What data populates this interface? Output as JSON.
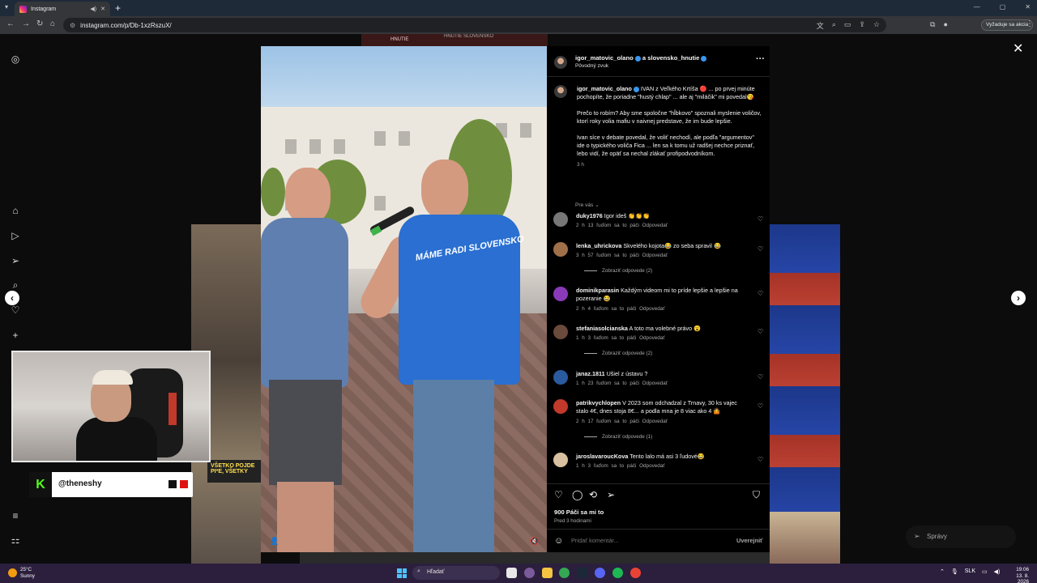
{
  "browser": {
    "tab_title": "Instagram",
    "url": "instagram.com/p/Db-1xzRszuX/",
    "action_pill": "Vyžaduje sa akcia"
  },
  "background": {
    "top_label_1": "HNUTIE",
    "top_label_2": "HNUTIE SLOVENSKO",
    "left_banner": "VŠETKO POJDE PI*E, VŠETKY"
  },
  "post": {
    "header_user": "igor_matovic_olano",
    "header_conj": "a",
    "header_user2": "slovensko_hnutie",
    "audio": "Pôvodný zvuk",
    "caption_user": "igor_matovic_olano",
    "caption_p1": "IVAN z Veľkého Krtíša 🔴 ... po prvej minúte pochopíte, že poriadne \"hustý chlap\" ... ale aj \"miláčik\" mi povedal😘",
    "caption_p2": "Prečo to robím? Aby sme spoločne \"hĺbkovo\" spoznali myslenie voličov, ktorí roky volia mafiu v naivnej predstave, že im bude lepšie.",
    "caption_p3": "Ivan síce v debate povedal, že voliť nechodí, ale podľa \"argumentov\" ide o typického voliča Fica ... len sa k tomu už radšej nechce priznať, lebo vidí, že opäť sa nechal zlákať profipodvodníkom.",
    "caption_time": "3 h",
    "see_translation": "Pre vás",
    "likes": "900 Páči sa mi to",
    "posted_ago": "Pred 3 hodinami",
    "comment_placeholder": "Pridať komentár...",
    "post_button": "Uverejniť"
  },
  "comments": [
    {
      "user": "duky1976",
      "text": "Igor ideš 👏👏👏",
      "meta": "2 h   13 ľuďom sa to páči   Odpovedať",
      "replies": ""
    },
    {
      "user": "lenka_uhrickova",
      "text": "Skvelého kojota😂 zo seba spravil 😂",
      "meta": "3 h   57 ľuďom sa to páči   Odpovedať",
      "replies": "Zobraziť odpovede (2)"
    },
    {
      "user": "dominikparasin",
      "text": "Každým videom mi to príde lepšie a lepšie na pozeranie 😂",
      "meta": "2 h   4 ľuďom sa to páči   Odpovedať",
      "replies": ""
    },
    {
      "user": "stefaniasolcianska",
      "text": "A toto ma volebné právo 😮",
      "meta": "1 h   3 ľuďom sa to páči   Odpovedať",
      "replies": "Zobraziť odpovede (2)"
    },
    {
      "user": "janaz.1811",
      "text": "Ušiel z ústavu ?",
      "meta": "1 h   23 ľuďom sa to páči   Odpovedať",
      "replies": ""
    },
    {
      "user": "patrikvychlopen",
      "text": "V 2023 som odchadzal z Trnavy, 30 ks vajec stalo 4€, dnes stoja 8€... a podla mna je 8 viac ako 4 🤷",
      "meta": "2 h   17 ľuďom sa to páči   Odpovedať",
      "replies": "Zobraziť odpovede (1)"
    },
    {
      "user": "jaroslavaroucKova",
      "text": "Tento lalo má asi 3 ľudové😂",
      "meta": "1 h   3 ľuďom sa to páči   Odpovedať",
      "replies": ""
    }
  ],
  "overlay": {
    "handle": "@theneshy",
    "kick_letter": "K"
  },
  "messages_label": "Správy",
  "video_shirt_text": "MÁME RADI SLOVENSKO",
  "taskbar": {
    "temp": "25°C",
    "weather": "Sunny",
    "search": "Hľadať",
    "lang": "SLK",
    "time": "19:06",
    "date": "13. 8. 2026"
  },
  "colors": {
    "verified": "#3897f0",
    "kick_green": "#53fc18",
    "panel_bg": "#000000"
  }
}
